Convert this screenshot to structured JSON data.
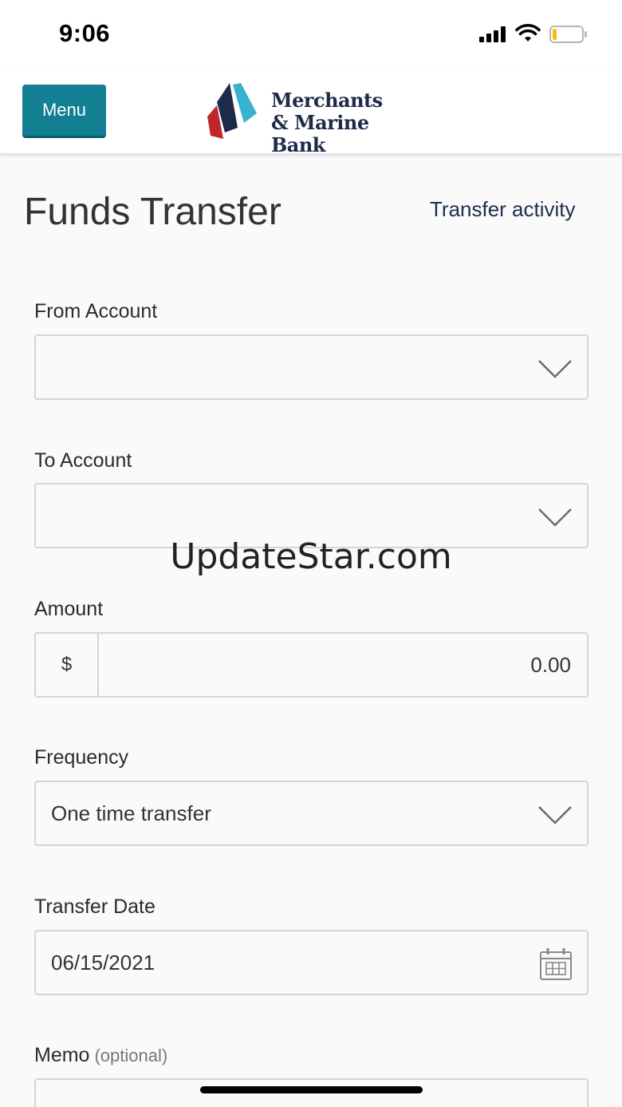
{
  "status_bar": {
    "time": "9:06",
    "signal_icon": "cellular-signal-icon",
    "wifi_icon": "wifi-icon",
    "battery_icon": "battery-low-icon",
    "battery_level": 0.12,
    "battery_color": "#f2c200"
  },
  "header": {
    "menu_label": "Menu",
    "menu_color": "#127f93",
    "logo_line1": "Merchants",
    "logo_line2": "& Marine Bank",
    "logo_colors": [
      "#c0272d",
      "#1e2a4a",
      "#36b3cf"
    ]
  },
  "page": {
    "title": "Funds Transfer",
    "activity_link": "Transfer activity"
  },
  "form": {
    "from_account": {
      "label": "From Account",
      "value": "",
      "icon": "chevron-down-icon"
    },
    "to_account": {
      "label": "To Account",
      "value": "",
      "icon": "chevron-down-icon"
    },
    "amount": {
      "label": "Amount",
      "prefix": "$",
      "value": "0.00"
    },
    "frequency": {
      "label": "Frequency",
      "value": "One time transfer",
      "icon": "chevron-down-icon"
    },
    "transfer_date": {
      "label": "Transfer Date",
      "value": "06/15/2021",
      "icon": "calendar-icon"
    },
    "memo": {
      "label": "Memo",
      "optional": "(optional)",
      "value": ""
    }
  },
  "watermark": "UpdateStar.com"
}
